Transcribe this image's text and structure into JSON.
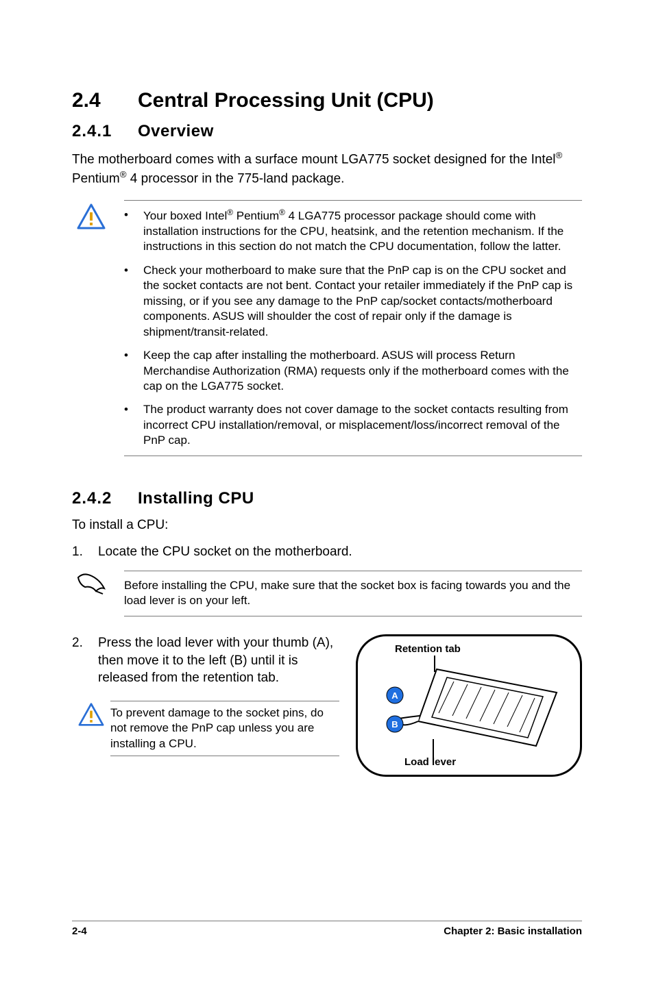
{
  "heading": {
    "number": "2.4",
    "title": "Central Processing Unit (CPU)"
  },
  "section1": {
    "number": "2.4.1",
    "title": "Overview",
    "intro_before": "The motherboard comes with a surface mount LGA775 socket designed for the Intel",
    "intro_after_1": " Pentium",
    "intro_after_2": " 4 processor in the 775-land package.",
    "notes": [
      {
        "pre": "Your boxed Intel",
        "mid": " Pentium",
        "post": " 4 LGA775 processor package should come with installation instructions for the CPU, heatsink, and the retention mechanism. If the instructions in this section do not match the CPU documentation, follow the latter."
      },
      {
        "text": "Check your motherboard to make sure that the PnP cap is on the CPU socket and the socket contacts are not bent. Contact your retailer immediately if the PnP cap is missing, or if you see any damage to the PnP cap/socket contacts/motherboard components. ASUS will shoulder the cost of repair only if the damage is shipment/transit-related."
      },
      {
        "text": "Keep the cap after installing the motherboard. ASUS will process Return Merchandise Authorization (RMA) requests only if the motherboard comes with the cap on the LGA775 socket."
      },
      {
        "text": "The product warranty does not cover damage to the socket contacts resulting from incorrect CPU installation/removal, or misplacement/loss/incorrect removal of the PnP cap."
      }
    ]
  },
  "section2": {
    "number": "2.4.2",
    "title": "Installing CPU",
    "intro": "To install a CPU:",
    "step1_num": "1.",
    "step1": "Locate the CPU socket on the motherboard.",
    "note": "Before installing the CPU, make sure that the socket box is facing towards you and the load lever is on your left.",
    "step2_num": "2.",
    "step2": "Press the load lever with your thumb (A), then move it to the left (B) until it is released from the retention tab.",
    "warn": "To prevent damage to the socket pins, do not remove the PnP cap unless you are installing a CPU.",
    "fig_top": "Retention tab",
    "fig_bot": "Load lever"
  },
  "footer": {
    "left": "2-4",
    "right": "Chapter 2: Basic installation"
  },
  "glyphs": {
    "reg": "®",
    "bullet": "•"
  }
}
